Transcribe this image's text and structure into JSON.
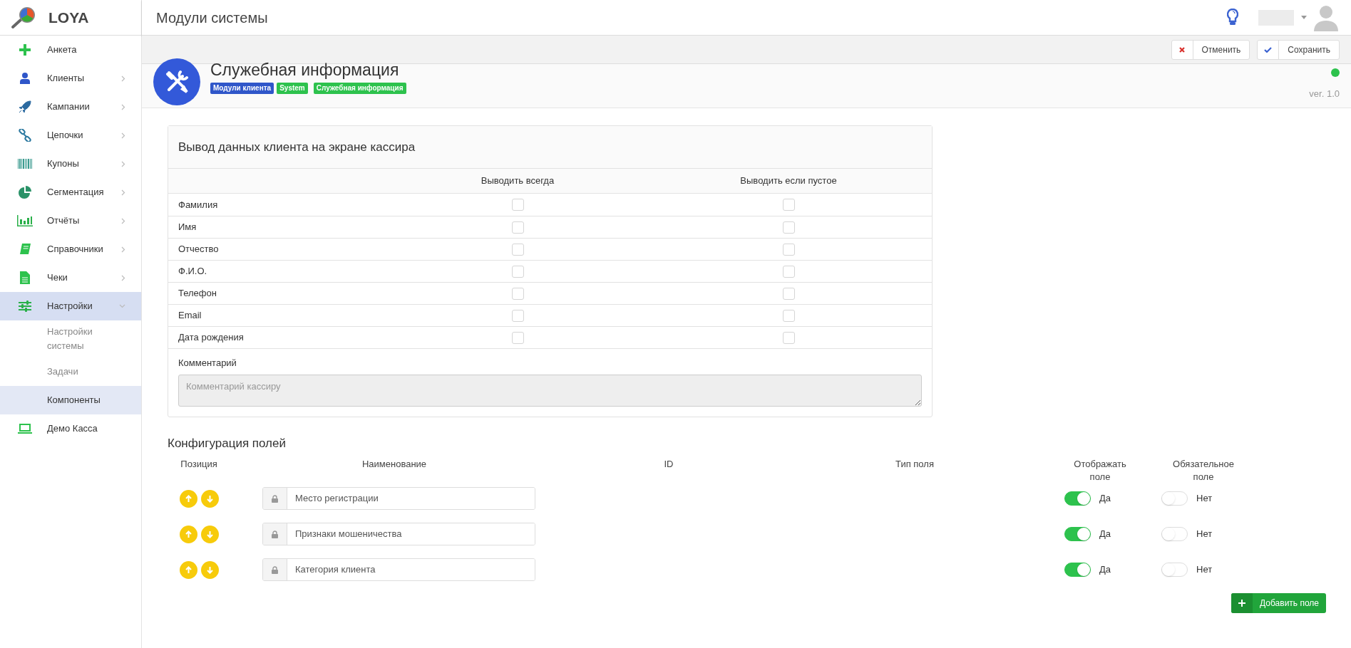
{
  "brand": "LOYA",
  "page_title": "Модули системы",
  "sidebar": {
    "items": [
      {
        "label": "Анкета",
        "selected": false
      },
      {
        "label": "Клиенты",
        "selected": false,
        "expanded": false
      },
      {
        "label": "Кампании",
        "selected": false,
        "expanded": false
      },
      {
        "label": "Цепочки",
        "selected": false,
        "expanded": false
      },
      {
        "label": "Купоны",
        "selected": false,
        "expanded": false
      },
      {
        "label": "Сегментация",
        "selected": false,
        "expanded": false
      },
      {
        "label": "Отчёты",
        "selected": false,
        "expanded": false
      },
      {
        "label": "Справочники",
        "selected": false,
        "expanded": false
      },
      {
        "label": "Чеки",
        "selected": false,
        "expanded": false
      },
      {
        "label": "Настройки",
        "selected": true,
        "expanded": true,
        "children": [
          {
            "label": "Настройки системы",
            "selected": false
          },
          {
            "label": "Задачи",
            "selected": false
          },
          {
            "label": "Компоненты",
            "selected": true
          }
        ]
      },
      {
        "label": "Демо Касса",
        "selected": false
      }
    ]
  },
  "toolbar": {
    "buttons": [
      {
        "kind": "cancel",
        "label": "Отменить"
      },
      {
        "kind": "save",
        "label": "Сохранить"
      }
    ]
  },
  "module": {
    "title": "Служебная информация",
    "active": true,
    "version": "ver. 1.0",
    "tags": [
      {
        "label": "Модули клиента",
        "color": "#2f56c9"
      },
      {
        "label": "System",
        "color": "#2dc24d"
      },
      {
        "label": "Служебная информация",
        "color": "#2dc24d"
      }
    ]
  },
  "display_card": {
    "title": "Вывод данных клиента на экране кассира",
    "columns": [
      "Выводить всегда",
      "Выводить если пустое"
    ],
    "rows": [
      {
        "label": "Фамилия",
        "always": false,
        "if_empty": false
      },
      {
        "label": "Имя",
        "always": false,
        "if_empty": false
      },
      {
        "label": "Отчество",
        "always": false,
        "if_empty": false
      },
      {
        "label": "Ф.И.О.",
        "always": false,
        "if_empty": false
      },
      {
        "label": "Телефон",
        "always": false,
        "if_empty": false
      },
      {
        "label": "Email",
        "always": false,
        "if_empty": false
      },
      {
        "label": "Дата рождения",
        "always": false,
        "if_empty": false
      }
    ],
    "comment": {
      "label": "Комментарий",
      "placeholder": "Комментарий кассиру"
    }
  },
  "config": {
    "title": "Конфигурация полей",
    "columns": [
      "Позиция",
      "Наименование",
      "ID",
      "Тип поля",
      "Отображать поле",
      "Обязательное поле"
    ],
    "rows": [
      {
        "name": "Место регистрации",
        "visible": true,
        "visible_label": "Да",
        "required": false,
        "required_label": "Нет"
      },
      {
        "name": "Признаки мошеничества",
        "visible": true,
        "visible_label": "Да",
        "required": false,
        "required_label": "Нет"
      },
      {
        "name": "Категория клиента",
        "visible": true,
        "visible_label": "Да",
        "required": false,
        "required_label": "Нет"
      }
    ],
    "add_button": "Добавить поле"
  }
}
